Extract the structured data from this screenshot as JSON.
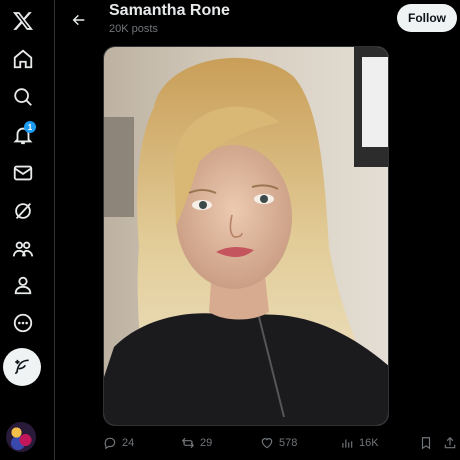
{
  "profile": {
    "name": "Samantha Rone",
    "posts_count": "20K posts",
    "follow_label": "Follow"
  },
  "nav": {
    "notifications_badge": "1",
    "items": [
      "x-logo-icon",
      "home-icon",
      "search-icon",
      "notifications-icon",
      "messages-icon",
      "grok-icon",
      "communities-icon",
      "profile-icon",
      "more-icon"
    ]
  },
  "post_stats": {
    "replies": "24",
    "reposts": "29",
    "likes": "578",
    "views": "16K"
  },
  "colors": {
    "background": "#000000",
    "accent": "#1d9bf0",
    "muted": "#71767b",
    "text": "#e7e9ea"
  }
}
